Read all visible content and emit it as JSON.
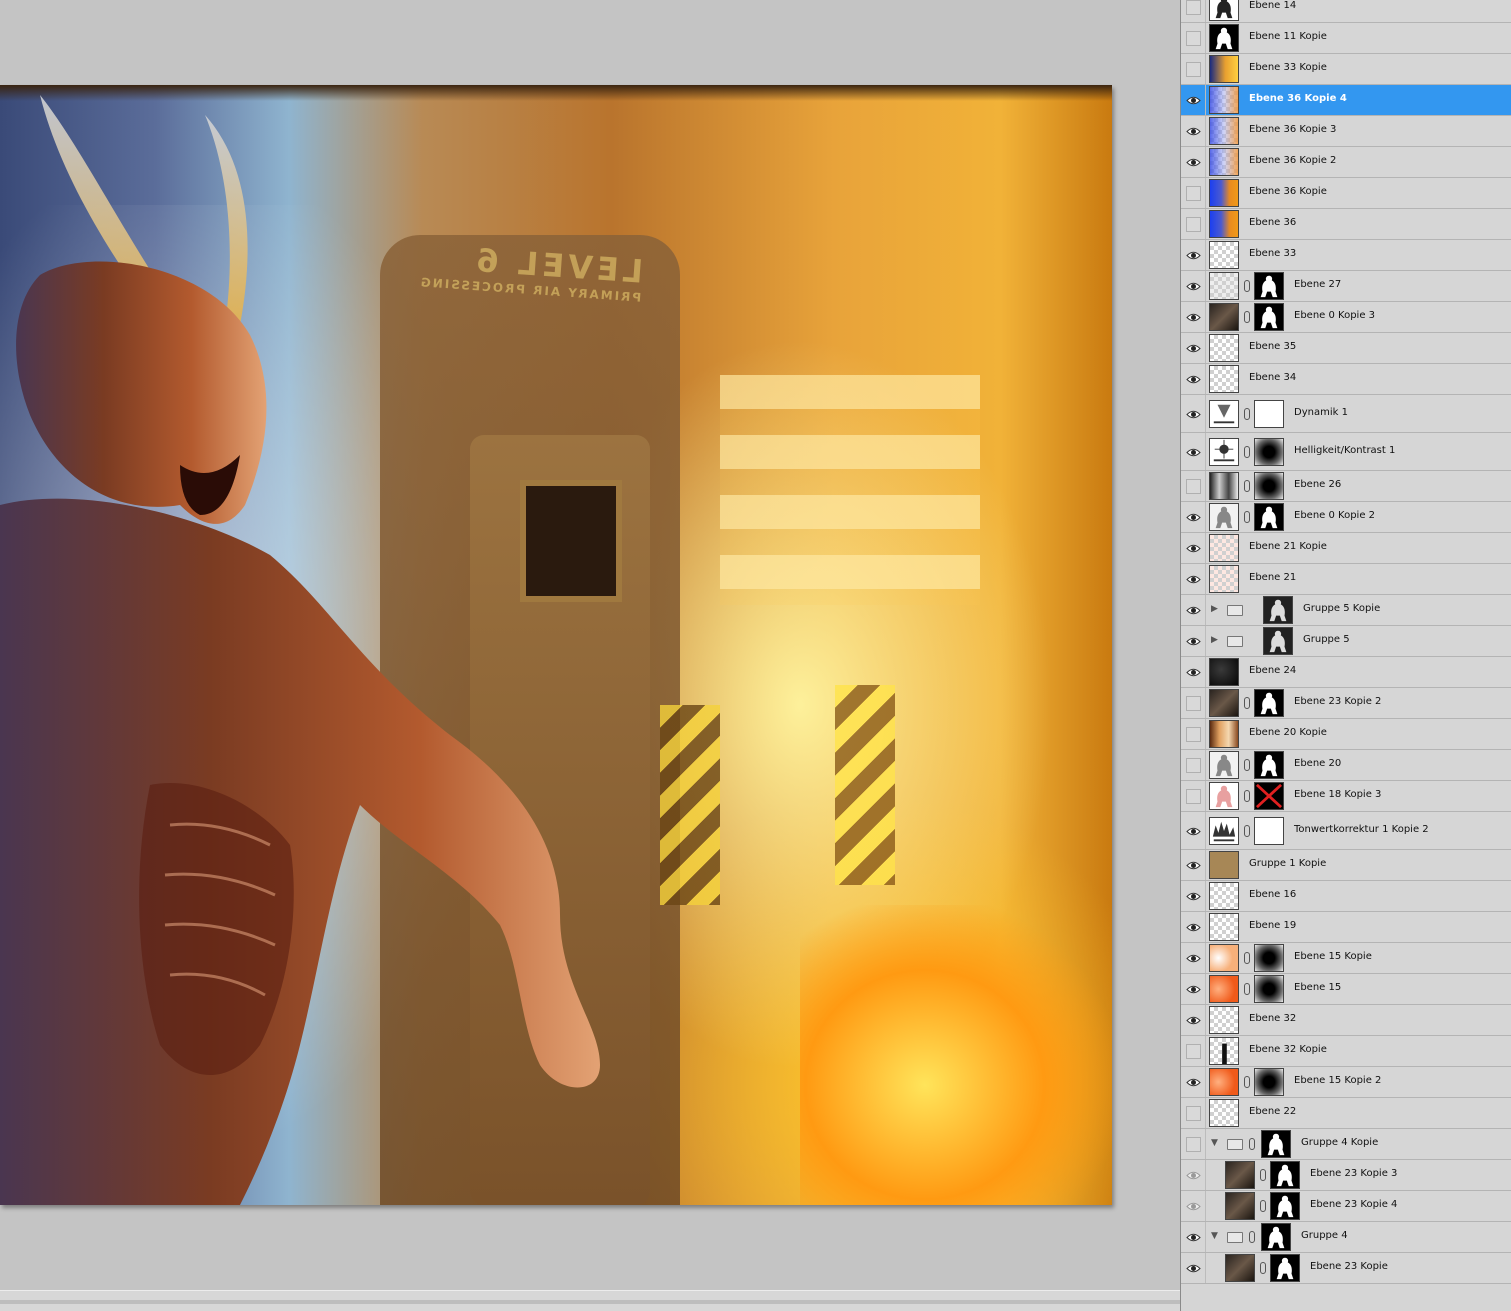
{
  "canvas": {
    "sign_text": "LEVEL 6",
    "sign_sub": "PRIMARY AIR PROCESSING"
  },
  "layers": [
    {
      "name": "Ebene 14",
      "visible": false,
      "thumb": "figure-white"
    },
    {
      "name": "Ebene 11 Kopie",
      "visible": false,
      "thumb": "figure-black"
    },
    {
      "name": "Ebene 33 Kopie",
      "visible": false,
      "thumb": "fire-photo"
    },
    {
      "name": "Ebene 36 Kopie 4",
      "visible": true,
      "thumb": "blue-orange-checker",
      "selected": true
    },
    {
      "name": "Ebene 36 Kopie 3",
      "visible": true,
      "thumb": "blue-orange-checker"
    },
    {
      "name": "Ebene 36 Kopie 2",
      "visible": true,
      "thumb": "blue-orange-checker"
    },
    {
      "name": "Ebene 36 Kopie",
      "visible": false,
      "thumb": "blue-orange"
    },
    {
      "name": "Ebene 36",
      "visible": false,
      "thumb": "blue-orange"
    },
    {
      "name": "Ebene 33",
      "visible": true,
      "thumb": "checker"
    },
    {
      "name": "Ebene 27",
      "visible": true,
      "thumb": "checker-dark",
      "mask": "figure-black"
    },
    {
      "name": "Ebene 0 Kopie 3",
      "visible": true,
      "thumb": "dark-photo",
      "mask": "figure-black"
    },
    {
      "name": "Ebene 35",
      "visible": true,
      "thumb": "checker"
    },
    {
      "name": "Ebene 34",
      "visible": true,
      "thumb": "checker"
    },
    {
      "name": "Dynamik 1",
      "visible": true,
      "thumb": "adjust-vibrance",
      "mask": "white",
      "tall": true
    },
    {
      "name": "Helligkeit/Kontrast 1",
      "visible": true,
      "thumb": "adjust-brightness",
      "mask": "radial-dark",
      "tall": true
    },
    {
      "name": "Ebene 26",
      "visible": false,
      "thumb": "bw-photo",
      "mask": "radial-dark"
    },
    {
      "name": "Ebene 0 Kopie 2",
      "visible": true,
      "thumb": "figure-light",
      "mask": "figure-black"
    },
    {
      "name": "Ebene 21 Kopie",
      "visible": true,
      "thumb": "checker-pink"
    },
    {
      "name": "Ebene 21",
      "visible": true,
      "thumb": "checker-pink"
    },
    {
      "name": "Gruppe 5 Kopie",
      "visible": true,
      "group": true,
      "expanded": false,
      "mask": "figure-dark"
    },
    {
      "name": "Gruppe 5",
      "visible": true,
      "group": true,
      "expanded": false,
      "mask": "figure-dark"
    },
    {
      "name": "Ebene 24",
      "visible": true,
      "thumb": "dark"
    },
    {
      "name": "Ebene 23 Kopie 2",
      "visible": false,
      "thumb": "dark-photo",
      "mask": "figure-black"
    },
    {
      "name": "Ebene 20 Kopie",
      "visible": false,
      "thumb": "warm-photo"
    },
    {
      "name": "Ebene 20",
      "visible": false,
      "thumb": "figure-light",
      "mask": "figure-black"
    },
    {
      "name": "Ebene 18 Kopie 3",
      "visible": false,
      "thumb": "red-figure",
      "mask": "red-x"
    },
    {
      "name": "Tonwertkorrektur 1 Kopie 2",
      "visible": true,
      "thumb": "adjust-levels",
      "mask": "white",
      "tall": true
    },
    {
      "name": "Gruppe 1 Kopie",
      "visible": true,
      "thumb": "brown"
    },
    {
      "name": "Ebene 16",
      "visible": true,
      "thumb": "checker"
    },
    {
      "name": "Ebene 19",
      "visible": true,
      "thumb": "checker"
    },
    {
      "name": "Ebene 15 Kopie",
      "visible": true,
      "thumb": "orange-light",
      "mask": "radial-dark"
    },
    {
      "name": "Ebene 15",
      "visible": true,
      "thumb": "orange",
      "mask": "radial-dark"
    },
    {
      "name": "Ebene 32",
      "visible": true,
      "thumb": "checker"
    },
    {
      "name": "Ebene 32 Kopie",
      "visible": false,
      "thumb": "checker-bar"
    },
    {
      "name": "Ebene 15 Kopie 2",
      "visible": true,
      "thumb": "orange",
      "mask": "radial-dark"
    },
    {
      "name": "Ebene 22",
      "visible": false,
      "thumb": "checker"
    },
    {
      "name": "Gruppe 4 Kopie",
      "visible": false,
      "group": true,
      "expanded": true,
      "mask": "figure-black",
      "chain": true
    },
    {
      "name": "Ebene 23 Kopie 3",
      "visible": "dim",
      "thumb": "dark-photo",
      "mask": "figure-black",
      "indent": true
    },
    {
      "name": "Ebene 23 Kopie 4",
      "visible": "dim",
      "thumb": "dark-photo",
      "mask": "figure-black",
      "indent": true
    },
    {
      "name": "Gruppe 4",
      "visible": true,
      "group": true,
      "expanded": true,
      "mask": "figure-black",
      "chain": true
    },
    {
      "name": "Ebene 23 Kopie",
      "visible": true,
      "thumb": "dark-photo",
      "mask": "figure-black",
      "indent": true
    }
  ]
}
